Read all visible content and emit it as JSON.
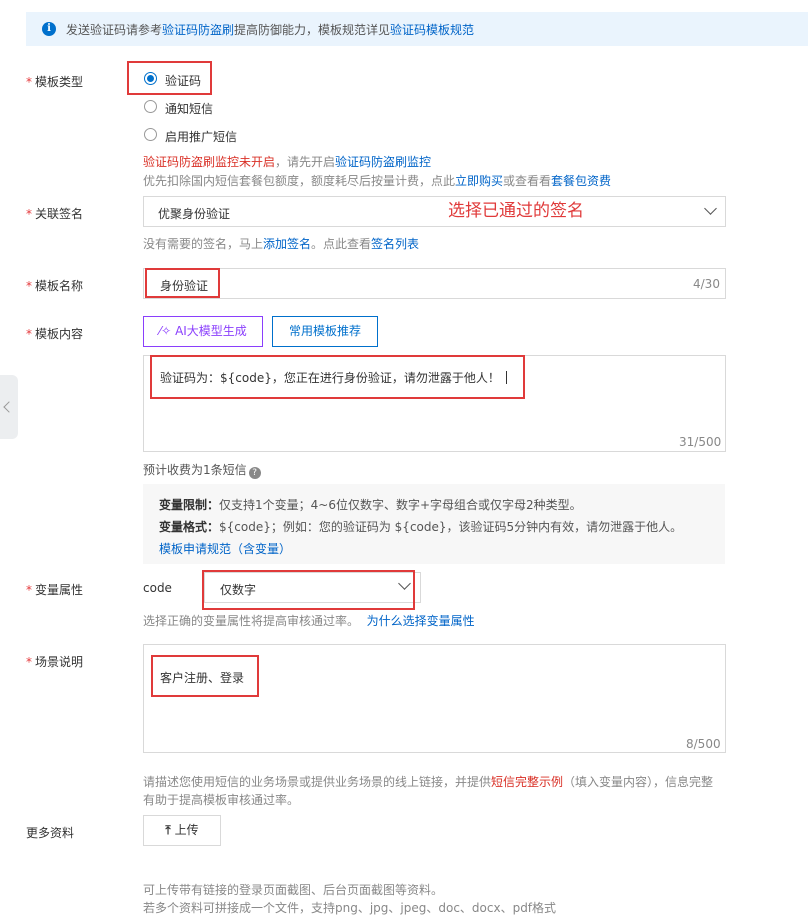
{
  "notice": {
    "prefix": "发送验证码请参考",
    "link1": "验证码防盗刷",
    "middle": "提高防御能力，模板规范详见",
    "link2": "验证码模板规范"
  },
  "template_type": {
    "label": "模板类型",
    "options": [
      "验证码",
      "通知短信",
      "启用推广短信"
    ],
    "selected": "验证码",
    "warn_red": "验证码防盗刷监控未开启",
    "warn_mid": "，请先开启",
    "warn_link": "验证码防盗刷监控",
    "billing_prefix": "优先扣除国内短信套餐包额度，额度耗尽后按量计费，点此",
    "billing_link1": "立即购买",
    "billing_mid": "或查看看",
    "billing_link2": "套餐包资费"
  },
  "signature": {
    "label": "关联签名",
    "value": "优聚身份验证",
    "annotation": "选择已通过的签名",
    "hint_prefix": "没有需要的签名，马上",
    "hint_link1": "添加签名",
    "hint_mid": "。点此查看",
    "hint_link2": "签名列表"
  },
  "template_name": {
    "label": "模板名称",
    "value": "身份验证",
    "counter": "4/30"
  },
  "template_content": {
    "label": "模板内容",
    "ai_button": "AI大模型生成",
    "recommend_button": "常用模板推荐",
    "value": "验证码为：${code}，您正在进行身份验证，请勿泄露于他人！",
    "counter": "31/500",
    "estimate": "预计收费为1条短信",
    "rule1_label": "变量限制：",
    "rule1_text": "仅支持1个变量；4~6位仅数字、数字+字母组合或仅字母2种类型。",
    "rule2_label": "变量格式：",
    "rule2_text": "${code}；例如：您的验证码为 ${code}，该验证码5分钟内有效，请勿泄露于他人。",
    "rule_link": "模板申请规范（含变量）"
  },
  "variable_attr": {
    "label": "变量属性",
    "var_name": "code",
    "value": "仅数字",
    "hint": "选择正确的变量属性将提高审核通过率。",
    "hint_link": "为什么选择变量属性"
  },
  "scene": {
    "label": "场景说明",
    "value": "客户注册、登录",
    "counter": "8/500",
    "hint1_prefix": "请描述您使用短信的业务场景或提供业务场景的线上链接，并提供",
    "hint1_link": "短信完整示例",
    "hint1_suffix": "（填入变量内容），信息完整",
    "hint2": "有助于提高模板审核通过率。"
  },
  "more_info": {
    "label": "更多资料",
    "upload_button": "上传",
    "hint1": "可上传带有链接的登录页面截图、后台页面截图等资料。",
    "hint2": "若多个资料可拼接成一个文件，支持png、jpg、jpeg、doc、docx、pdf格式"
  },
  "colors": {
    "accent": "#0070cc",
    "annotation_red": "#e03a3a",
    "ai_purple": "#8a3ffc"
  }
}
